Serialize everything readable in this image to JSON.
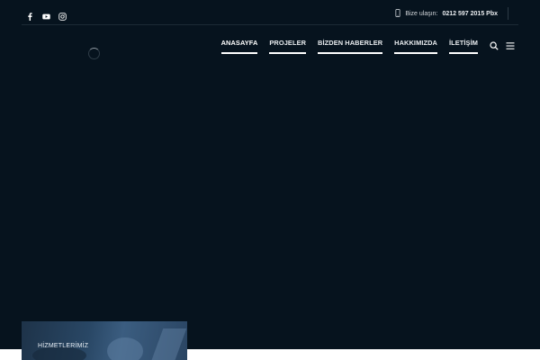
{
  "topbar": {
    "social": [
      "facebook-icon",
      "youtube-icon",
      "instagram-icon"
    ],
    "contact_label": "Bize ulaşın:",
    "contact_phone": "0212 597 2015 Pbx"
  },
  "nav": {
    "items": [
      {
        "label": "ANASAYFA"
      },
      {
        "label": "PROJELER"
      },
      {
        "label": "BİZDEN HABERLER"
      },
      {
        "label": "HAKKIMIZDA"
      },
      {
        "label": "İLETİŞİM"
      }
    ]
  },
  "services_card": {
    "title": "HİZMETLERİMİZ"
  },
  "colors": {
    "hero_background": "#06131e",
    "nav_text": "#e8ecef",
    "card_accent": "#294765"
  }
}
